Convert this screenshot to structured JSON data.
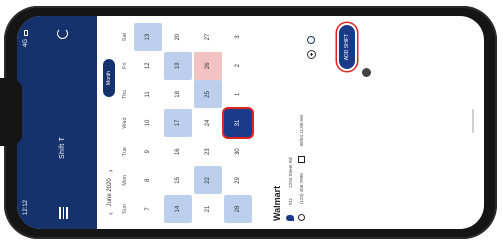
{
  "status_bar": {
    "time": "12:12",
    "signal": "4G"
  },
  "app_bar": {
    "title": "Shift T",
    "menu_icon": "menu-icon",
    "refresh_icon": "refresh-icon"
  },
  "calendar": {
    "month": "June 2020",
    "view_toggle": "Month",
    "weekdays": [
      "Sun",
      "Mon",
      "Tue",
      "Wed",
      "Thu",
      "Fri",
      "Sat"
    ],
    "weeks": [
      [
        {
          "d": "7",
          "s": "plain"
        },
        {
          "d": "8",
          "s": "plain"
        },
        {
          "d": "9",
          "s": "plain"
        },
        {
          "d": "10",
          "s": "plain"
        },
        {
          "d": "11",
          "s": "plain"
        },
        {
          "d": "12",
          "s": "plain"
        },
        {
          "d": "13",
          "s": "shade"
        }
      ],
      [
        {
          "d": "14",
          "s": "shade"
        },
        {
          "d": "15",
          "s": "plain"
        },
        {
          "d": "16",
          "s": "plain"
        },
        {
          "d": "17",
          "s": "shade"
        },
        {
          "d": "18",
          "s": "plain"
        },
        {
          "d": "19",
          "s": "shade"
        },
        {
          "d": "20",
          "s": "plain"
        }
      ],
      [
        {
          "d": "21",
          "s": "plain"
        },
        {
          "d": "22",
          "s": "shade"
        },
        {
          "d": "23",
          "s": "plain"
        },
        {
          "d": "24",
          "s": "plain"
        },
        {
          "d": "25",
          "s": "shade"
        },
        {
          "d": "26",
          "s": "pink"
        },
        {
          "d": "27",
          "s": "plain"
        }
      ],
      [
        {
          "d": "28",
          "s": "shade"
        },
        {
          "d": "29",
          "s": "plain"
        },
        {
          "d": "30",
          "s": "plain"
        },
        {
          "d": "31",
          "s": "today"
        },
        {
          "d": "1",
          "s": "plain"
        },
        {
          "d": "2",
          "s": "plain"
        },
        {
          "d": "3",
          "s": "plain"
        }
      ]
    ]
  },
  "store": {
    "name": "Walmart",
    "id_label": "#11",
    "address": "1234 Street Rd",
    "phone": "(123) 456-7890",
    "date": "06/04 11:00 AM"
  },
  "fab": {
    "label": "ADD SHIFT"
  },
  "colors": {
    "primary": "#16326c",
    "accent": "#1c3a8a",
    "highlight": "#e0231f",
    "shade": "#bcd0ee",
    "pink": "#f2c2c2"
  }
}
